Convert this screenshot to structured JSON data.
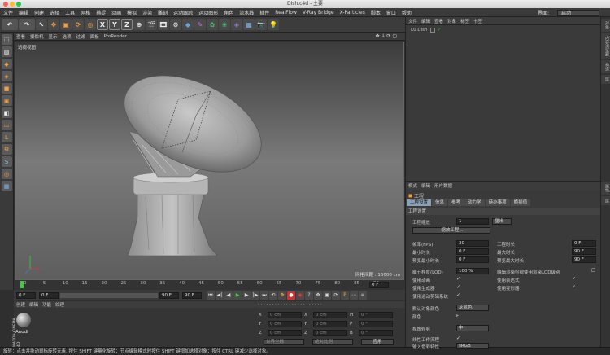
{
  "window": {
    "title": "Dish.c4d - 主要"
  },
  "menu": [
    "文件",
    "编辑",
    "创建",
    "选择",
    "工具",
    "网格",
    "捕捉",
    "动画",
    "模拟",
    "渲染",
    "雕刻",
    "运动跟踪",
    "运动图形",
    "角色",
    "流水线",
    "插件",
    "RealFlow",
    "V-Ray Bridge",
    "X-Particles",
    "脚本",
    "窗口",
    "帮助"
  ],
  "layout": {
    "label": "界面:",
    "value": "启动"
  },
  "toolbar": {
    "axis_x": "X",
    "axis_y": "Y",
    "axis_z": "Z"
  },
  "viewport": {
    "menu": [
      "查看",
      "摄像机",
      "显示",
      "选项",
      "过滤",
      "面板",
      "ProRender"
    ],
    "name": "透视视图",
    "grid_spacing": "网格间距 : 10000 cm"
  },
  "timeline": {
    "ticks": [
      "0",
      "5",
      "10",
      "15",
      "20",
      "25",
      "30",
      "35",
      "40",
      "45",
      "50",
      "55",
      "60",
      "65",
      "70",
      "75",
      "80",
      "85",
      "90"
    ],
    "current_frame": "0 F",
    "start": "0 F",
    "min": "0 F",
    "max": "90 F",
    "end": "90 F"
  },
  "materials": {
    "menu": [
      "创建",
      "编辑",
      "功能",
      "纹理"
    ],
    "item_label": "Anodi"
  },
  "coords": {
    "rows": [
      {
        "axis": "X",
        "pos": "0 cm",
        "mid_axis": "X",
        "size": "0 cm",
        "rot_axis": "H",
        "rot": "0 °"
      },
      {
        "axis": "Y",
        "pos": "0 cm",
        "mid_axis": "Y",
        "size": "0 cm",
        "rot_axis": "P",
        "rot": "0 °"
      },
      {
        "axis": "Z",
        "pos": "0 cm",
        "mid_axis": "Z",
        "size": "0 cm",
        "rot_axis": "B",
        "rot": "0 °"
      }
    ],
    "mode1": "世界坐标",
    "mode2": "绝对比例",
    "apply": "应用"
  },
  "status": "旋转：点击并拖动鼠标旋转元素. 按住 SHIFT 键量化旋转；节点编辑模式时按住 SHIFT 键增加选择对象；按住 CTRL 键减少选择对象。",
  "objects": {
    "menu": [
      "文件",
      "编辑",
      "查看",
      "对象",
      "标签",
      "书签"
    ],
    "item": "L0 Dish"
  },
  "attributes": {
    "menu": [
      "模式",
      "编辑",
      "用户数据"
    ],
    "header": "工程",
    "tabs": [
      "工程设置",
      "信息",
      "参考",
      "动力学",
      "待办事项",
      "帧插值"
    ],
    "active_tab": "工程设置",
    "section": "工程设置",
    "scale_label": "工程缩放",
    "scale_value": "1",
    "scale_unit": "厘米",
    "scale_btn": "缩放工程...",
    "fps_label": "帧率(FPS)",
    "fps_value": "30",
    "min_label": "最小时长",
    "min_value": "0 F",
    "prev_min_label": "预览最小时长",
    "prev_min_value": "0 F",
    "len_label": "工程时长",
    "len_value": "0 F",
    "max_label": "最大时长",
    "max_value": "90 F",
    "prev_max_label": "预览最大时长",
    "prev_max_value": "90 F",
    "lod_label": "细节程度(LOD)",
    "lod_value": "100 %",
    "lod_render_label": "编辑渲染检视使用渲染LOD级别",
    "use_anim": "使用动画",
    "use_expr": "使用表达式",
    "use_gen": "使用生成器",
    "use_deform": "使用变形器",
    "use_motion": "使用运动剪辑系统",
    "default_color_label": "默认对象颜色",
    "default_color_value": "灰蓝色",
    "color_label": "颜色",
    "view_clip_label": "视图修剪",
    "view_clip_value": "中",
    "linear_label": "线性工作流程",
    "input_color_label": "输入色彩特性",
    "input_color_value": "sRGB"
  },
  "right_tabs": [
    "对象",
    "内容浏览器",
    "构造",
    "层"
  ],
  "right_tabs_bottom": [
    "属性",
    "层"
  ],
  "brand": "MAXON CINEMA 4D"
}
